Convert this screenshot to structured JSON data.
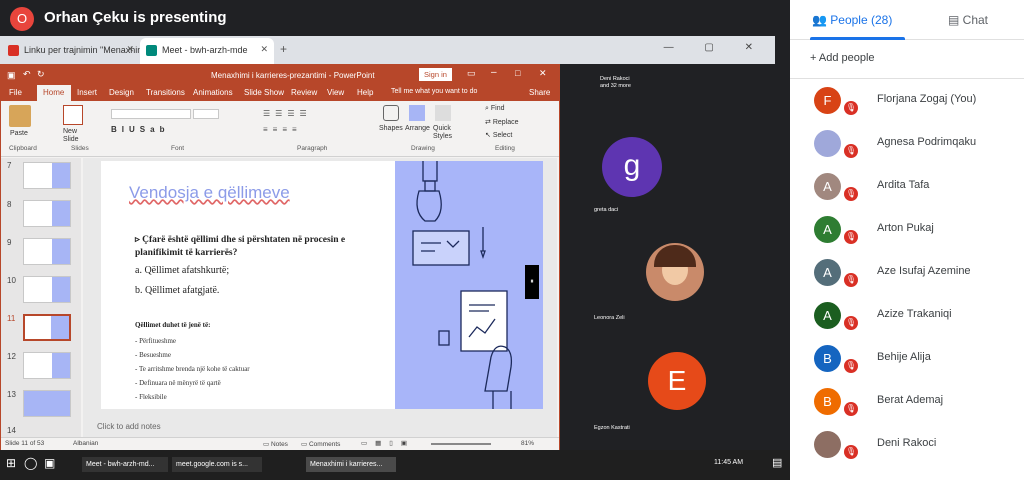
{
  "meet": {
    "presenter_initial": "O",
    "presenter_text": "Orhan Çeku is presenting"
  },
  "browser": {
    "tabs": [
      {
        "label": "Linku per trajnimin \"Menaxhimi...",
        "fav_color": "#d93025"
      },
      {
        "label": "Meet - bwh-arzh-mde",
        "fav_color": "#00897b"
      }
    ],
    "window_controls": "— ▢ ✕"
  },
  "powerpoint": {
    "title": "Menaxhimi i karrieres-prezantimi - PowerPoint",
    "sign_in": "Sign in",
    "menu": [
      "File",
      "Home",
      "Insert",
      "Design",
      "Transitions",
      "Animations",
      "Slide Show",
      "Review",
      "View",
      "Help",
      "Tell me what you want to do",
      "Share"
    ],
    "ribbon": {
      "paste": "Paste",
      "new_slide": "New Slide",
      "shapes": "Shapes",
      "arrange": "Arrange",
      "quick_styles": "Quick Styles",
      "find": "Find",
      "replace": "Replace",
      "select": "Select",
      "groups": [
        "Clipboard",
        "Slides",
        "Font",
        "Paragraph",
        "Drawing",
        "Editing"
      ]
    },
    "thumb_numbers": [
      "7",
      "8",
      "9",
      "10",
      "11",
      "12",
      "13",
      "14"
    ],
    "slide": {
      "title": "Vendosja e qëllimeve",
      "question": "Çfarë është qëllimi dhe si përshtaten në procesin e planifikimit të karrierës?",
      "item_a": "a. Qëllimet afatshkurtë;",
      "item_b": "b. Qëllimet afatgjatë.",
      "subheading": "Qëllimet duhet të jenë të:",
      "bullets": [
        "- Përfitueshme",
        "- Besueshme",
        "- Te arritshme brenda një kohe të caktuar",
        "- Definuara në mënyrë të qartë",
        "- Fleksibile"
      ]
    },
    "notes_placeholder": "Click to add notes",
    "status": {
      "slide_count": "Slide 11 of 53",
      "language": "Albanian",
      "notes": "Notes",
      "comments": "Comments",
      "zoom": "81%"
    }
  },
  "videos": {
    "header_name": "Deni Rakoci",
    "header_more": "and 32 more",
    "tiles": [
      {
        "initial": "g",
        "color": "#5e35b1",
        "name": "greta daci"
      },
      {
        "initial": "",
        "color": "#c98a6a",
        "name": "Leonora Zeli"
      },
      {
        "initial": "E",
        "color": "#e64a19",
        "name": "Egzon Kastrati"
      }
    ]
  },
  "panel": {
    "people_tab": "People (28)",
    "chat_tab": "Chat",
    "add_people": "Add people",
    "people": [
      {
        "initial": "F",
        "color": "#d84315",
        "name": "Florjana Zogaj (You)"
      },
      {
        "initial": "",
        "color": "#9fa8da",
        "name": "Agnesa Podrimqaku"
      },
      {
        "initial": "A",
        "color": "#a1887f",
        "name": "Ardita Tafa"
      },
      {
        "initial": "A",
        "color": "#2e7d32",
        "name": "Arton Pukaj"
      },
      {
        "initial": "A",
        "color": "#546e7a",
        "name": "Aze Isufaj Azemine"
      },
      {
        "initial": "A",
        "color": "#1b5e20",
        "name": "Azize Trakaniqi"
      },
      {
        "initial": "B",
        "color": "#1565c0",
        "name": "Behije Alija"
      },
      {
        "initial": "B",
        "color": "#ef6c00",
        "name": "Berat Ademaj"
      },
      {
        "initial": "",
        "color": "#8d6e63",
        "name": "Deni Rakoci"
      }
    ]
  },
  "taskbar": {
    "items": [
      "Meet - bwh-arzh-md...",
      "meet.google.com is s...",
      "Menaxhimi i karrieres..."
    ],
    "time": "11:45 AM"
  }
}
